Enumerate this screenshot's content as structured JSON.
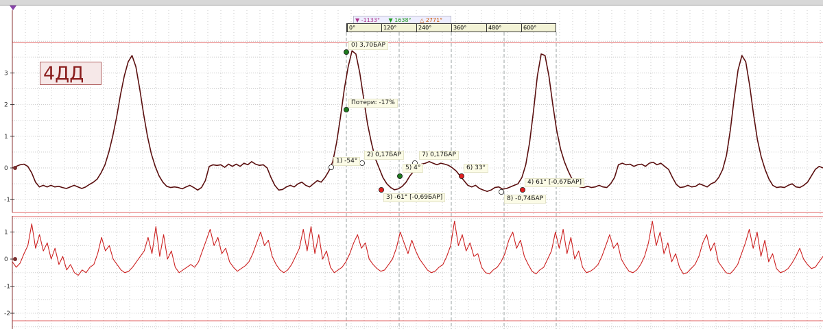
{
  "colors": {
    "trace_top": "#5a0f0f",
    "trace_bottom": "#cc2020",
    "grid": "#c8c8c8",
    "red_line": "#e06060",
    "point_green": "#1e7a1e",
    "point_red": "#e02020",
    "point_white": "#ffffff",
    "axis_marker": "#7a3030",
    "toolbar_triangle": "#8844aa"
  },
  "engine_label": "4ДД",
  "marker_readout": {
    "m1": "-1133°",
    "m2": "1638°",
    "m3": "2771°",
    "m1_color": "#aa3388",
    "m2_color": "#229922",
    "m3_color": "#cc5500"
  },
  "angle_ruler": [
    "0°",
    "120°",
    "240°",
    "360°",
    "480°",
    "600°"
  ],
  "annotations": [
    {
      "id": "0",
      "text": "0) 3,70БАР"
    },
    {
      "id": "loss",
      "text": "Потери: -17%"
    },
    {
      "id": "1",
      "text": "1) -54°"
    },
    {
      "id": "2",
      "text": "2) 0,17БАР"
    },
    {
      "id": "3",
      "text": "3) -61° [-0,69БАР]"
    },
    {
      "id": "4",
      "text": "4) 61° [-0,67БАР]"
    },
    {
      "id": "5",
      "text": "5) 4°"
    },
    {
      "id": "6",
      "text": "6) 33°"
    },
    {
      "id": "7",
      "text": "7) 0,17БАР"
    },
    {
      "id": "8",
      "text": "8) -0,74БАР"
    }
  ],
  "chart_data": [
    {
      "type": "line",
      "name": "top",
      "y_ticks": [
        "3",
        "2",
        "1",
        "0",
        "-1"
      ],
      "ylim": [
        -1.45,
        3.95
      ],
      "grid": true,
      "series": [
        {
          "values": [
            0,
            0.05,
            0.1,
            0.12,
            0.05,
            -0.15,
            -0.45,
            -0.6,
            -0.55,
            -0.6,
            -0.55,
            -0.6,
            -0.58,
            -0.62,
            -0.65,
            -0.6,
            -0.55,
            -0.6,
            -0.65,
            -0.6,
            -0.52,
            -0.45,
            -0.35,
            -0.15,
            0.1,
            0.5,
            1.0,
            1.6,
            2.3,
            2.9,
            3.35,
            3.55,
            3.2,
            2.5,
            1.7,
            1.0,
            0.45,
            0.05,
            -0.25,
            -0.45,
            -0.58,
            -0.62,
            -0.6,
            -0.62,
            -0.66,
            -0.6,
            -0.55,
            -0.62,
            -0.7,
            -0.62,
            -0.4,
            0.05,
            0.1,
            0.08,
            0.1,
            0.02,
            0.12,
            0.05,
            0.12,
            0.05,
            0.15,
            0.1,
            0.2,
            0.12,
            0.08,
            0.1,
            0.0,
            -0.3,
            -0.55,
            -0.7,
            -0.68,
            -0.6,
            -0.55,
            -0.6,
            -0.5,
            -0.45,
            -0.55,
            -0.6,
            -0.5,
            -0.4,
            -0.45,
            -0.3,
            -0.1,
            0.2,
            0.8,
            1.6,
            2.5,
            3.2,
            3.7,
            3.6,
            3.0,
            2.2,
            1.4,
            0.8,
            0.3,
            0.0,
            -0.3,
            -0.5,
            -0.62,
            -0.69,
            -0.66,
            -0.58,
            -0.45,
            -0.25,
            -0.1,
            0.05,
            0.12,
            0.15,
            0.2,
            0.15,
            0.1,
            0.15,
            0.12,
            0.08,
            0.0,
            -0.1,
            -0.25,
            -0.4,
            -0.55,
            -0.6,
            -0.55,
            -0.65,
            -0.7,
            -0.74,
            -0.7,
            -0.62,
            -0.6,
            -0.67,
            -0.65,
            -0.6,
            -0.55,
            -0.5,
            -0.3,
            0.1,
            0.8,
            1.8,
            2.9,
            3.6,
            3.55,
            2.9,
            2.0,
            1.2,
            0.6,
            0.2,
            -0.1,
            -0.35,
            -0.5,
            -0.6,
            -0.62,
            -0.58,
            -0.62,
            -0.6,
            -0.55,
            -0.6,
            -0.62,
            -0.5,
            -0.3,
            0.1,
            0.15,
            0.1,
            0.12,
            0.05,
            0.1,
            0.12,
            0.05,
            0.15,
            0.18,
            0.1,
            0.15,
            0.05,
            -0.05,
            -0.3,
            -0.52,
            -0.62,
            -0.6,
            -0.55,
            -0.6,
            -0.58,
            -0.5,
            -0.55,
            -0.6,
            -0.5,
            -0.45,
            -0.3,
            -0.05,
            0.4,
            1.2,
            2.2,
            3.1,
            3.55,
            3.35,
            2.6,
            1.7,
            0.9,
            0.35,
            -0.05,
            -0.35,
            -0.55,
            -0.62,
            -0.6,
            -0.62,
            -0.55,
            -0.5,
            -0.6,
            -0.62,
            -0.55,
            -0.45,
            -0.25,
            -0.05,
            0.05,
            0.0
          ]
        }
      ]
    },
    {
      "type": "line",
      "name": "bottom",
      "y_ticks": [
        "1",
        "0",
        "-1",
        "-2"
      ],
      "ylim": [
        -2.2,
        1.45
      ],
      "grid": true,
      "series": [
        {
          "values": [
            -0.1,
            -0.3,
            -0.15,
            0.2,
            0.5,
            1.3,
            0.4,
            0.9,
            0.3,
            0.6,
            0.0,
            0.4,
            -0.2,
            0.1,
            -0.4,
            -0.2,
            -0.5,
            -0.6,
            -0.4,
            -0.5,
            -0.3,
            -0.2,
            0.2,
            0.8,
            0.3,
            0.5,
            0.0,
            -0.2,
            -0.4,
            -0.5,
            -0.45,
            -0.3,
            -0.1,
            0.1,
            0.3,
            0.8,
            0.2,
            1.2,
            0.1,
            0.9,
            0.0,
            0.3,
            -0.3,
            -0.5,
            -0.4,
            -0.3,
            -0.2,
            -0.3,
            -0.1,
            0.3,
            0.7,
            1.1,
            0.5,
            0.8,
            0.2,
            0.4,
            -0.1,
            -0.3,
            -0.45,
            -0.35,
            -0.25,
            -0.1,
            0.2,
            0.6,
            1.0,
            0.5,
            0.7,
            0.1,
            -0.2,
            -0.4,
            -0.5,
            -0.4,
            -0.2,
            0.1,
            0.4,
            1.1,
            0.3,
            1.2,
            0.2,
            0.9,
            0.0,
            0.3,
            -0.3,
            -0.5,
            -0.4,
            -0.3,
            -0.1,
            0.2,
            0.6,
            0.9,
            0.4,
            0.6,
            0.0,
            -0.2,
            -0.35,
            -0.45,
            -0.4,
            -0.2,
            0.0,
            0.4,
            1.0,
            0.6,
            0.2,
            0.7,
            0.3,
            0.0,
            -0.2,
            -0.4,
            -0.5,
            -0.45,
            -0.3,
            -0.2,
            0.1,
            0.5,
            1.4,
            0.5,
            0.9,
            0.3,
            0.6,
            0.1,
            0.2,
            -0.3,
            -0.5,
            -0.55,
            -0.4,
            -0.3,
            -0.1,
            0.2,
            0.7,
            1.0,
            0.4,
            0.7,
            0.1,
            -0.2,
            -0.45,
            -0.55,
            -0.4,
            -0.3,
            0.0,
            0.3,
            1.0,
            0.4,
            1.1,
            0.2,
            0.8,
            0.0,
            0.3,
            -0.3,
            -0.5,
            -0.45,
            -0.35,
            -0.2,
            0.1,
            0.5,
            0.9,
            0.4,
            0.6,
            0.0,
            -0.25,
            -0.45,
            -0.5,
            -0.4,
            -0.2,
            0.1,
            0.6,
            1.4,
            0.5,
            1.0,
            0.2,
            0.6,
            -0.1,
            0.2,
            -0.3,
            -0.55,
            -0.5,
            -0.35,
            -0.2,
            0.1,
            0.6,
            0.9,
            0.3,
            0.6,
            -0.1,
            -0.3,
            -0.5,
            -0.55,
            -0.4,
            -0.2,
            0.2,
            0.6,
            1.1,
            0.4,
            1.0,
            0.1,
            0.7,
            -0.1,
            0.2,
            -0.35,
            -0.5,
            -0.45,
            -0.35,
            -0.15,
            0.1,
            0.4,
            0.0,
            -0.2,
            -0.35,
            -0.3,
            -0.1,
            0.1
          ]
        }
      ]
    }
  ]
}
